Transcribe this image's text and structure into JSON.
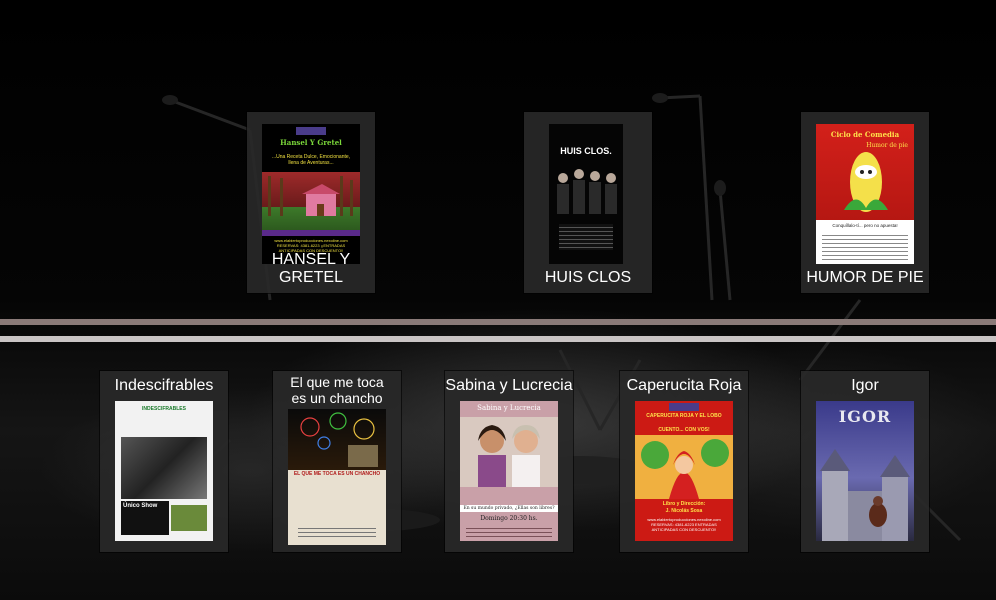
{
  "top_row": [
    {
      "title": "HANSEL Y GRETEL",
      "poster": {
        "heading": "Hansel Y Gretel",
        "tagline": "...Una Receta Dulce, Emocionante, llena de Aventuras...",
        "footer": "www.elabiertoproducciones.nexoline.com RESERVAS: 4381-6223 ¡¡ENTRADAS ANTICIPADAS CON DESCUENTO!!"
      }
    },
    {
      "title": "HUIS CLOS",
      "poster": {
        "heading": "HUIS CLOS."
      }
    },
    {
      "title": "HUMOR DE PIE",
      "poster": {
        "heading": "Ciclo de Comedia",
        "subheading": "Humor de pie",
        "footer": "Conquíllalo-tí... pero no apuesta!"
      }
    }
  ],
  "bottom_row": [
    {
      "title": "Indescifrables",
      "poster": {
        "heading": "INDESCIFRABLES",
        "badge": "Único Show"
      }
    },
    {
      "title_line1": "El que me toca",
      "title_line2": "es un chancho",
      "poster": {
        "heading": "EL QUE ME TOCA ES UN CHANCHO"
      }
    },
    {
      "title": "Sabina y Lucrecia",
      "poster": {
        "heading": "Sabina y Lucrecia",
        "line": "En su mundo privado, ¿Ellas son libres?",
        "time": "Domingo 20:30 hs."
      }
    },
    {
      "title": "Caperucita Roja",
      "poster": {
        "heading": "CAPERUCITA ROJA Y EL LOBO",
        "sub": "CUENTO... CON VOS!",
        "credit_label": "Libro y Dirección:",
        "credit_name": "J. Nicolás Sosa",
        "footer": "www.elabiertoproducciones.nexoline.com RESERVAS: 4381-6223 ENTRADAS ANTICIPADAS CON DESCUENTO!!"
      }
    },
    {
      "title": "Igor",
      "poster": {
        "heading": "IGOR"
      }
    }
  ]
}
